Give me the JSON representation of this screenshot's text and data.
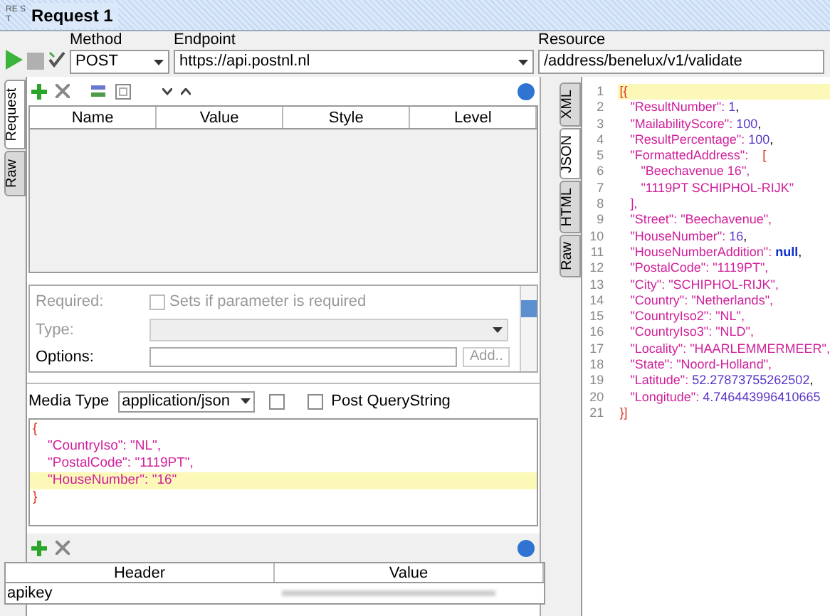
{
  "window": {
    "logo": "RE ST",
    "title": "Request 1"
  },
  "toolbar": {
    "method": {
      "label": "Method",
      "value": "POST"
    },
    "endpoint": {
      "label": "Endpoint",
      "value": "https://api.postnl.nl"
    },
    "resource": {
      "label": "Resource",
      "value": "/address/benelux/v1/validate"
    }
  },
  "request_tabs": [
    {
      "label": "Request",
      "selected": true
    },
    {
      "label": "Raw",
      "selected": false
    }
  ],
  "params_table": {
    "columns": [
      "Name",
      "Value",
      "Style",
      "Level"
    ]
  },
  "properties": {
    "required": {
      "label": "Required:",
      "checkbox_label": "Sets if parameter is required",
      "checked": false
    },
    "type": {
      "label": "Type:"
    },
    "options": {
      "label": "Options:",
      "button": "Add.."
    }
  },
  "media": {
    "label": "Media Type",
    "value": "application/json",
    "post_querystring": {
      "label": "Post QueryString",
      "checked": false
    }
  },
  "body_lines": [
    {
      "highlighted": false,
      "segments": [
        {
          "text": "{",
          "kind": "bracket"
        }
      ]
    },
    {
      "highlighted": false,
      "segments": [
        {
          "text": "    \"CountryIso\": \"NL\",",
          "kind": "key"
        }
      ]
    },
    {
      "highlighted": false,
      "segments": [
        {
          "text": "    \"PostalCode\": \"1119PT\",",
          "kind": "key"
        }
      ]
    },
    {
      "highlighted": true,
      "segments": [
        {
          "text": "    \"HouseNumber\": \"16\"",
          "kind": "key"
        }
      ]
    },
    {
      "highlighted": false,
      "segments": [
        {
          "text": "}",
          "kind": "bracket"
        }
      ]
    }
  ],
  "headers_table": {
    "columns": [
      "Header",
      "Value"
    ],
    "rows": [
      {
        "header": "apikey"
      }
    ]
  },
  "response_tabs": [
    {
      "label": "XML",
      "selected": false
    },
    {
      "label": "JSON",
      "selected": true
    },
    {
      "label": "HTML",
      "selected": false
    },
    {
      "label": "Raw",
      "selected": false
    }
  ],
  "response_lines": [
    {
      "n": "1",
      "highlighted": true,
      "segments": [
        {
          "text": "[{",
          "kind": "bracket"
        }
      ]
    },
    {
      "n": "2",
      "highlighted": false,
      "segments": [
        {
          "text": "   \"ResultNumber\": ",
          "kind": "key"
        },
        {
          "text": "1",
          "kind": "number"
        },
        {
          "text": ",",
          "kind": "punct"
        }
      ]
    },
    {
      "n": "3",
      "highlighted": false,
      "segments": [
        {
          "text": "   \"MailabilityScore\": ",
          "kind": "key"
        },
        {
          "text": "100",
          "kind": "number"
        },
        {
          "text": ",",
          "kind": "punct"
        }
      ]
    },
    {
      "n": "4",
      "highlighted": false,
      "segments": [
        {
          "text": "   \"ResultPercentage\": ",
          "kind": "key"
        },
        {
          "text": "100",
          "kind": "number"
        },
        {
          "text": ",",
          "kind": "punct"
        }
      ]
    },
    {
      "n": "5",
      "highlighted": false,
      "segments": [
        {
          "text": "   \"FormattedAddress\":    ",
          "kind": "key"
        },
        {
          "text": "[",
          "kind": "bracket"
        }
      ]
    },
    {
      "n": "6",
      "highlighted": false,
      "segments": [
        {
          "text": "      \"Beechavenue 16\",",
          "kind": "key"
        }
      ]
    },
    {
      "n": "7",
      "highlighted": false,
      "segments": [
        {
          "text": "      \"1119PT SCHIPHOL-RIJK\"",
          "kind": "key"
        }
      ]
    },
    {
      "n": "8",
      "highlighted": false,
      "segments": [
        {
          "text": "   ],",
          "kind": "key"
        }
      ]
    },
    {
      "n": "9",
      "highlighted": false,
      "segments": [
        {
          "text": "   \"Street\": \"Beechavenue\",",
          "kind": "key"
        }
      ]
    },
    {
      "n": "10",
      "highlighted": false,
      "segments": [
        {
          "text": "   \"HouseNumber\": ",
          "kind": "key"
        },
        {
          "text": "16",
          "kind": "number"
        },
        {
          "text": ",",
          "kind": "punct"
        }
      ]
    },
    {
      "n": "11",
      "highlighted": false,
      "segments": [
        {
          "text": "   \"HouseNumberAddition\": ",
          "kind": "key"
        },
        {
          "text": "null",
          "kind": "null"
        },
        {
          "text": ",",
          "kind": "punct"
        }
      ]
    },
    {
      "n": "12",
      "highlighted": false,
      "segments": [
        {
          "text": "   \"PostalCode\": \"1119PT\",",
          "kind": "key"
        }
      ]
    },
    {
      "n": "13",
      "highlighted": false,
      "segments": [
        {
          "text": "   \"City\": \"SCHIPHOL-RIJK\",",
          "kind": "key"
        }
      ]
    },
    {
      "n": "14",
      "highlighted": false,
      "segments": [
        {
          "text": "   \"Country\": \"Netherlands\",",
          "kind": "key"
        }
      ]
    },
    {
      "n": "15",
      "highlighted": false,
      "segments": [
        {
          "text": "   \"CountryIso2\": \"NL\",",
          "kind": "key"
        }
      ]
    },
    {
      "n": "16",
      "highlighted": false,
      "segments": [
        {
          "text": "   \"CountryIso3\": \"NLD\",",
          "kind": "key"
        }
      ]
    },
    {
      "n": "17",
      "highlighted": false,
      "segments": [
        {
          "text": "   \"Locality\": \"HAARLEMMERMEER\",",
          "kind": "key"
        }
      ]
    },
    {
      "n": "18",
      "highlighted": false,
      "segments": [
        {
          "text": "   \"State\": \"Noord-Holland\",",
          "kind": "key"
        }
      ]
    },
    {
      "n": "19",
      "highlighted": false,
      "segments": [
        {
          "text": "   \"Latitude\": ",
          "kind": "key"
        },
        {
          "text": "52.27873755262502",
          "kind": "number"
        },
        {
          "text": ",",
          "kind": "punct"
        }
      ]
    },
    {
      "n": "20",
      "highlighted": false,
      "segments": [
        {
          "text": "   \"Longitude\": ",
          "kind": "key"
        },
        {
          "text": "4.746443996410665",
          "kind": "number"
        }
      ]
    },
    {
      "n": "21",
      "highlighted": false,
      "segments": [
        {
          "text": "}]",
          "kind": "bracket"
        }
      ]
    }
  ]
}
